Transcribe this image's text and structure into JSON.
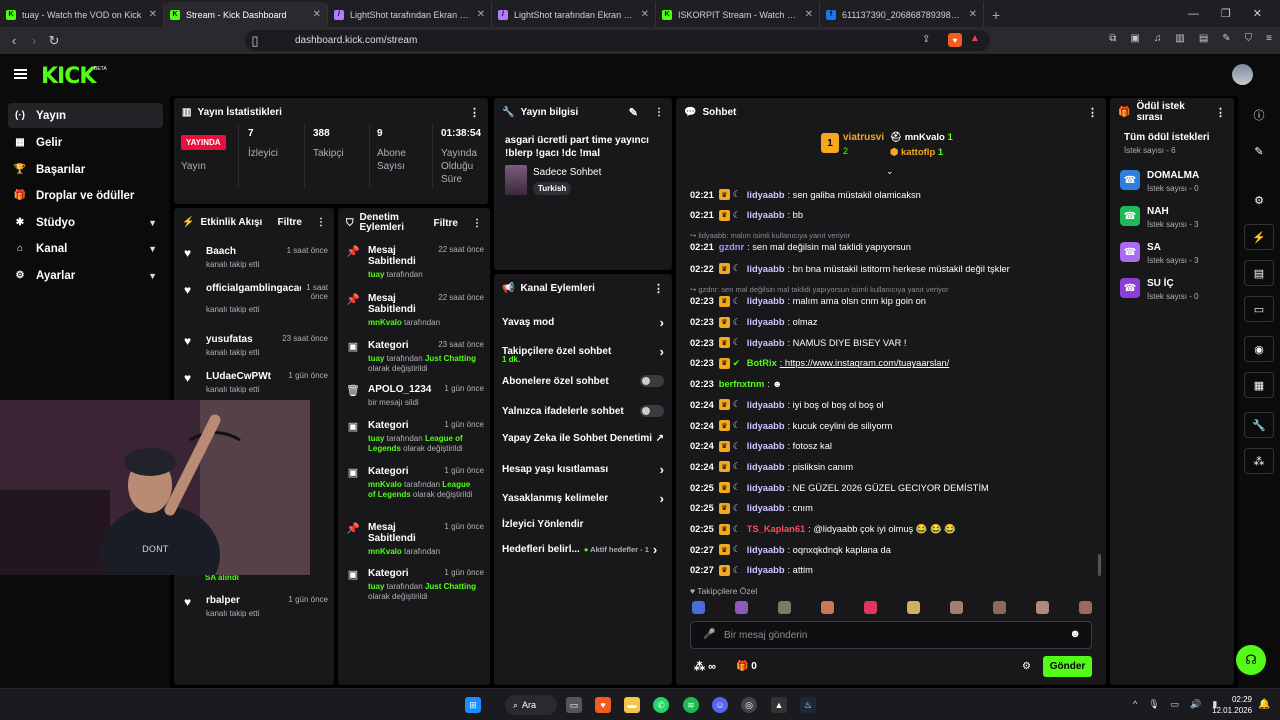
{
  "browser": {
    "tabs": [
      {
        "title": "tuay - Watch the VOD on Kick",
        "color": "#53fc18",
        "glyph": "K",
        "active": false
      },
      {
        "title": "Stream - Kick Dashboard",
        "color": "#53fc18",
        "glyph": "K",
        "active": true
      },
      {
        "title": "LightShot tarafından Ekran Görüntüsü",
        "color": "#b37bff",
        "glyph": "/",
        "active": false
      },
      {
        "title": "LightShot tarafından Ekran Görüntüsü",
        "color": "#b37bff",
        "glyph": "/",
        "active": false
      },
      {
        "title": "ISKORPIT Stream - Watch Live on Kick",
        "color": "#53fc18",
        "glyph": "K",
        "active": false
      },
      {
        "title": "611137390_2068687893986498_7974...",
        "color": "#1877f2",
        "glyph": "f",
        "active": false
      }
    ],
    "add_tab": "+",
    "url": "dashboard.kick.com/stream"
  },
  "brand": {
    "logo": "KICK",
    "beta": "BETA"
  },
  "sidebar": {
    "items": [
      {
        "label": "Yayın",
        "icon": "(·)",
        "active": true,
        "chevron": false
      },
      {
        "label": "Gelir",
        "icon": "▦",
        "active": false,
        "chevron": false
      },
      {
        "label": "Başarılar",
        "icon": "🏆",
        "active": false,
        "chevron": false
      },
      {
        "label": "Droplar ve ödüller",
        "icon": "🎁",
        "active": false,
        "chevron": false
      },
      {
        "label": "Stüdyo",
        "icon": "✱",
        "active": false,
        "chevron": true
      },
      {
        "label": "Kanal",
        "icon": "⌂",
        "active": false,
        "chevron": true
      },
      {
        "label": "Ayarlar",
        "icon": "⚙",
        "active": false,
        "chevron": true
      }
    ]
  },
  "stats": {
    "title": "Yayın İstatistikleri",
    "live_badge": "YAYINDA",
    "live_label": "Yayın",
    "items": [
      {
        "value": "7",
        "label": "İzleyici"
      },
      {
        "value": "388",
        "label": "Takipçi"
      },
      {
        "value": "9",
        "label": "Abone Sayısı"
      },
      {
        "value": "01:38:54",
        "label": "Yayında Olduğu Süre"
      }
    ]
  },
  "activity": {
    "title": "Etkinlik Akışı",
    "filter": "Filtre",
    "events": [
      {
        "name": "Baach",
        "desc": "kanalı takip etti",
        "time": "1 saat önce"
      },
      {
        "name": "officialgamblingacademy",
        "desc": "kanalı takip etti",
        "time": "1 saat önce"
      },
      {
        "name": "yusufatas",
        "desc": "kanalı takip etti",
        "time": "23 saat önce"
      },
      {
        "name": "LUdaeCwPWt",
        "desc": "kanalı takip etti",
        "time": "1 gün önce"
      },
      {
        "name": "rbalper",
        "desc": "kanalı takip etti",
        "time": "1 gün önce"
      }
    ],
    "partial_text": "SA alındı"
  },
  "mod_actions": {
    "title": "Denetim Eylemleri",
    "filter": "Filtre",
    "items": [
      {
        "icon": "📌",
        "title": "Mesaj Sabitlendi",
        "time": "22 saat önce",
        "user": "tuay",
        "rest": " tarafından",
        "extra": ""
      },
      {
        "icon": "📌",
        "title": "Mesaj Sabitlendi",
        "time": "22 saat önce",
        "user": "mnKvalo",
        "rest": " tarafından",
        "extra": ""
      },
      {
        "icon": "▣",
        "title": "Kategori",
        "time": "23 saat önce",
        "user": "tuay",
        "rest": " tarafından ",
        "extra": "Just Chatting",
        "tail": " olarak değiştirildi"
      },
      {
        "icon": "🗑",
        "title": "APOLO_1234",
        "time": "1 gün önce",
        "user": "",
        "rest": "bir mesajı sildi",
        "extra": ""
      },
      {
        "icon": "▣",
        "title": "Kategori",
        "time": "1 gün önce",
        "user": "tuay",
        "rest": " tarafından ",
        "extra": "League of Legends",
        "tail": " olarak değiştirildi"
      },
      {
        "icon": "▣",
        "title": "Kategori",
        "time": "1 gün önce",
        "user": "mnKvalo",
        "rest": " tarafından ",
        "extra": "League of Legends",
        "tail": " olarak değiştirildi"
      },
      {
        "icon": "📌",
        "title": "Mesaj Sabitlendi",
        "time": "1 gün önce",
        "user": "mnKvalo",
        "rest": " tarafından",
        "extra": ""
      },
      {
        "icon": "▣",
        "title": "Kategori",
        "time": "1 gün önce",
        "user": "tuay",
        "rest": " tarafından ",
        "extra": "Just Chatting",
        "tail": " olarak değiştirildi"
      }
    ]
  },
  "stream_info": {
    "title": "Yayın bilgisi",
    "stream_title": "asgari ücretli part time yayıncı !blerp !gacı !dc !mal",
    "category": "Sadece Sohbet",
    "tag": "Turkish"
  },
  "channel_actions": {
    "title": "Kanal Eylemleri",
    "items": [
      {
        "label": "Yavaş mod",
        "kind": "arrow"
      },
      {
        "label": "Takipçilere özel sohbet",
        "sub": "1 dk.",
        "kind": "arrow"
      },
      {
        "label": "Abonelere özel sohbet",
        "kind": "toggle"
      },
      {
        "label": "Yalnızca ifadelerle sohbet",
        "kind": "toggle"
      },
      {
        "label": "Yapay Zeka ile Sohbet Denetimi",
        "kind": "ext"
      },
      {
        "label": "Hesap yaşı kısıtlaması",
        "kind": "arrow"
      },
      {
        "label": "Yasaklanmış kelimeler",
        "kind": "arrow"
      },
      {
        "label": "İzleyici Yönlendir",
        "kind": "none"
      },
      {
        "label": "Hedefleri belirl...",
        "sub2": "Aktif hedefler - 1",
        "kind": "arrow"
      }
    ]
  },
  "chat": {
    "title": "Sohbet",
    "top_gifters": [
      {
        "rank": "1",
        "name": "viatrusvi",
        "count": "2"
      },
      {
        "name": "mnKvalo",
        "count": "1"
      },
      {
        "name": "kattoflp",
        "count": "1"
      }
    ],
    "messages": [
      {
        "time": "02:21",
        "user": "lidyaabb",
        "color": "#c9c9ff",
        "text": ": sen galiba müstakil olamicaksn",
        "reply": ""
      },
      {
        "time": "02:21",
        "user": "lidyaabb",
        "color": "#c9c9ff",
        "text": ": bb",
        "reply": ""
      },
      {
        "time": "02:21",
        "user": "gzdnr",
        "color": "#9b9bff",
        "text": ": sen mal değilsin mal taklidi yapıyorsun",
        "reply": "lidyaabb: malım isimli kullanıcıya yanıt veriyor"
      },
      {
        "time": "02:22",
        "user": "lidyaabb",
        "color": "#c9c9ff",
        "text": ": bn bna müstakil istitorm herkese müstakil değil tşkler",
        "reply": ""
      },
      {
        "time": "02:23",
        "user": "lidyaabb",
        "color": "#c9c9ff",
        "text": ": malım ama olsn cnm kip goin on",
        "reply": "gzdnr: sen mal değilsin mal taklidi yapıyorsun isimli kullanıcıya yanıt veriyor"
      },
      {
        "time": "02:23",
        "user": "lidyaabb",
        "color": "#c9c9ff",
        "text": ": olmaz",
        "reply": ""
      },
      {
        "time": "02:23",
        "user": "lidyaabb",
        "color": "#c9c9ff",
        "text": ": NAMUS DIYE BISEY VAR !",
        "reply": ""
      },
      {
        "time": "02:23",
        "user": "BotRix",
        "color": "#53fc18",
        "text": ": https://www.instagram.com/tuayaarslan/",
        "reply": ""
      },
      {
        "time": "02:23",
        "user": "berfnxtnm",
        "color": "#53fc18",
        "text": ": ☻",
        "reply": ""
      },
      {
        "time": "02:24",
        "user": "lidyaabb",
        "color": "#c9c9ff",
        "text": ": iyi boş ol boş ol boş ol",
        "reply": ""
      },
      {
        "time": "02:24",
        "user": "lidyaabb",
        "color": "#c9c9ff",
        "text": ": kucuk ceylini de siliyorm",
        "reply": ""
      },
      {
        "time": "02:24",
        "user": "lidyaabb",
        "color": "#c9c9ff",
        "text": ": fotosz kal",
        "reply": ""
      },
      {
        "time": "02:24",
        "user": "lidyaabb",
        "color": "#c9c9ff",
        "text": ": pisliksin canım",
        "reply": ""
      },
      {
        "time": "02:25",
        "user": "lidyaabb",
        "color": "#c9c9ff",
        "text": ": NE GÜZEL 2026 GÜZEL GECIYOR DEMİSTİM",
        "reply": ""
      },
      {
        "time": "02:25",
        "user": "lidyaabb",
        "color": "#c9c9ff",
        "text": ": cnım",
        "reply": ""
      },
      {
        "time": "02:25",
        "user": "TS_Kaplan61",
        "color": "#ff4b5c",
        "text": ": @lidyaabb çok iyi olmuş 😂 😂 😂",
        "reply": ""
      },
      {
        "time": "02:27",
        "user": "lidyaabb",
        "color": "#c9c9ff",
        "text": ": oqnxqkdnqk kaplana da",
        "reply": ""
      },
      {
        "time": "02:27",
        "user": "lidyaabb",
        "color": "#c9c9ff",
        "text": ": attim",
        "reply": ""
      }
    ],
    "followers_label": "Takipçilere Özel",
    "input_placeholder": "Bir mesaj gönderin",
    "points": "∞",
    "gift_count": "0",
    "send_label": "Gönder"
  },
  "rewards": {
    "title": "Ödül istek sırası",
    "all_label": "Tüm ödül istekleri",
    "all_count": "İstek sayısı - 6",
    "items": [
      {
        "name": "DOMALMA",
        "count": "İstek sayısı - 0",
        "color": "#2f7fe0"
      },
      {
        "name": "NAH",
        "count": "İstek sayısı - 3",
        "color": "#1db954"
      },
      {
        "name": "SA",
        "count": "İstek sayısı - 3",
        "color": "#a86cf0"
      },
      {
        "name": "SU İÇ",
        "count": "İstek sayısı - 0",
        "color": "#8b3fd8"
      }
    ]
  },
  "taskbar": {
    "search": "Ara",
    "time": "02:29",
    "date": "12.01.2026"
  },
  "colors": {
    "accent": "#53fc18",
    "panel": "#18181b",
    "live": "#e9113c"
  }
}
